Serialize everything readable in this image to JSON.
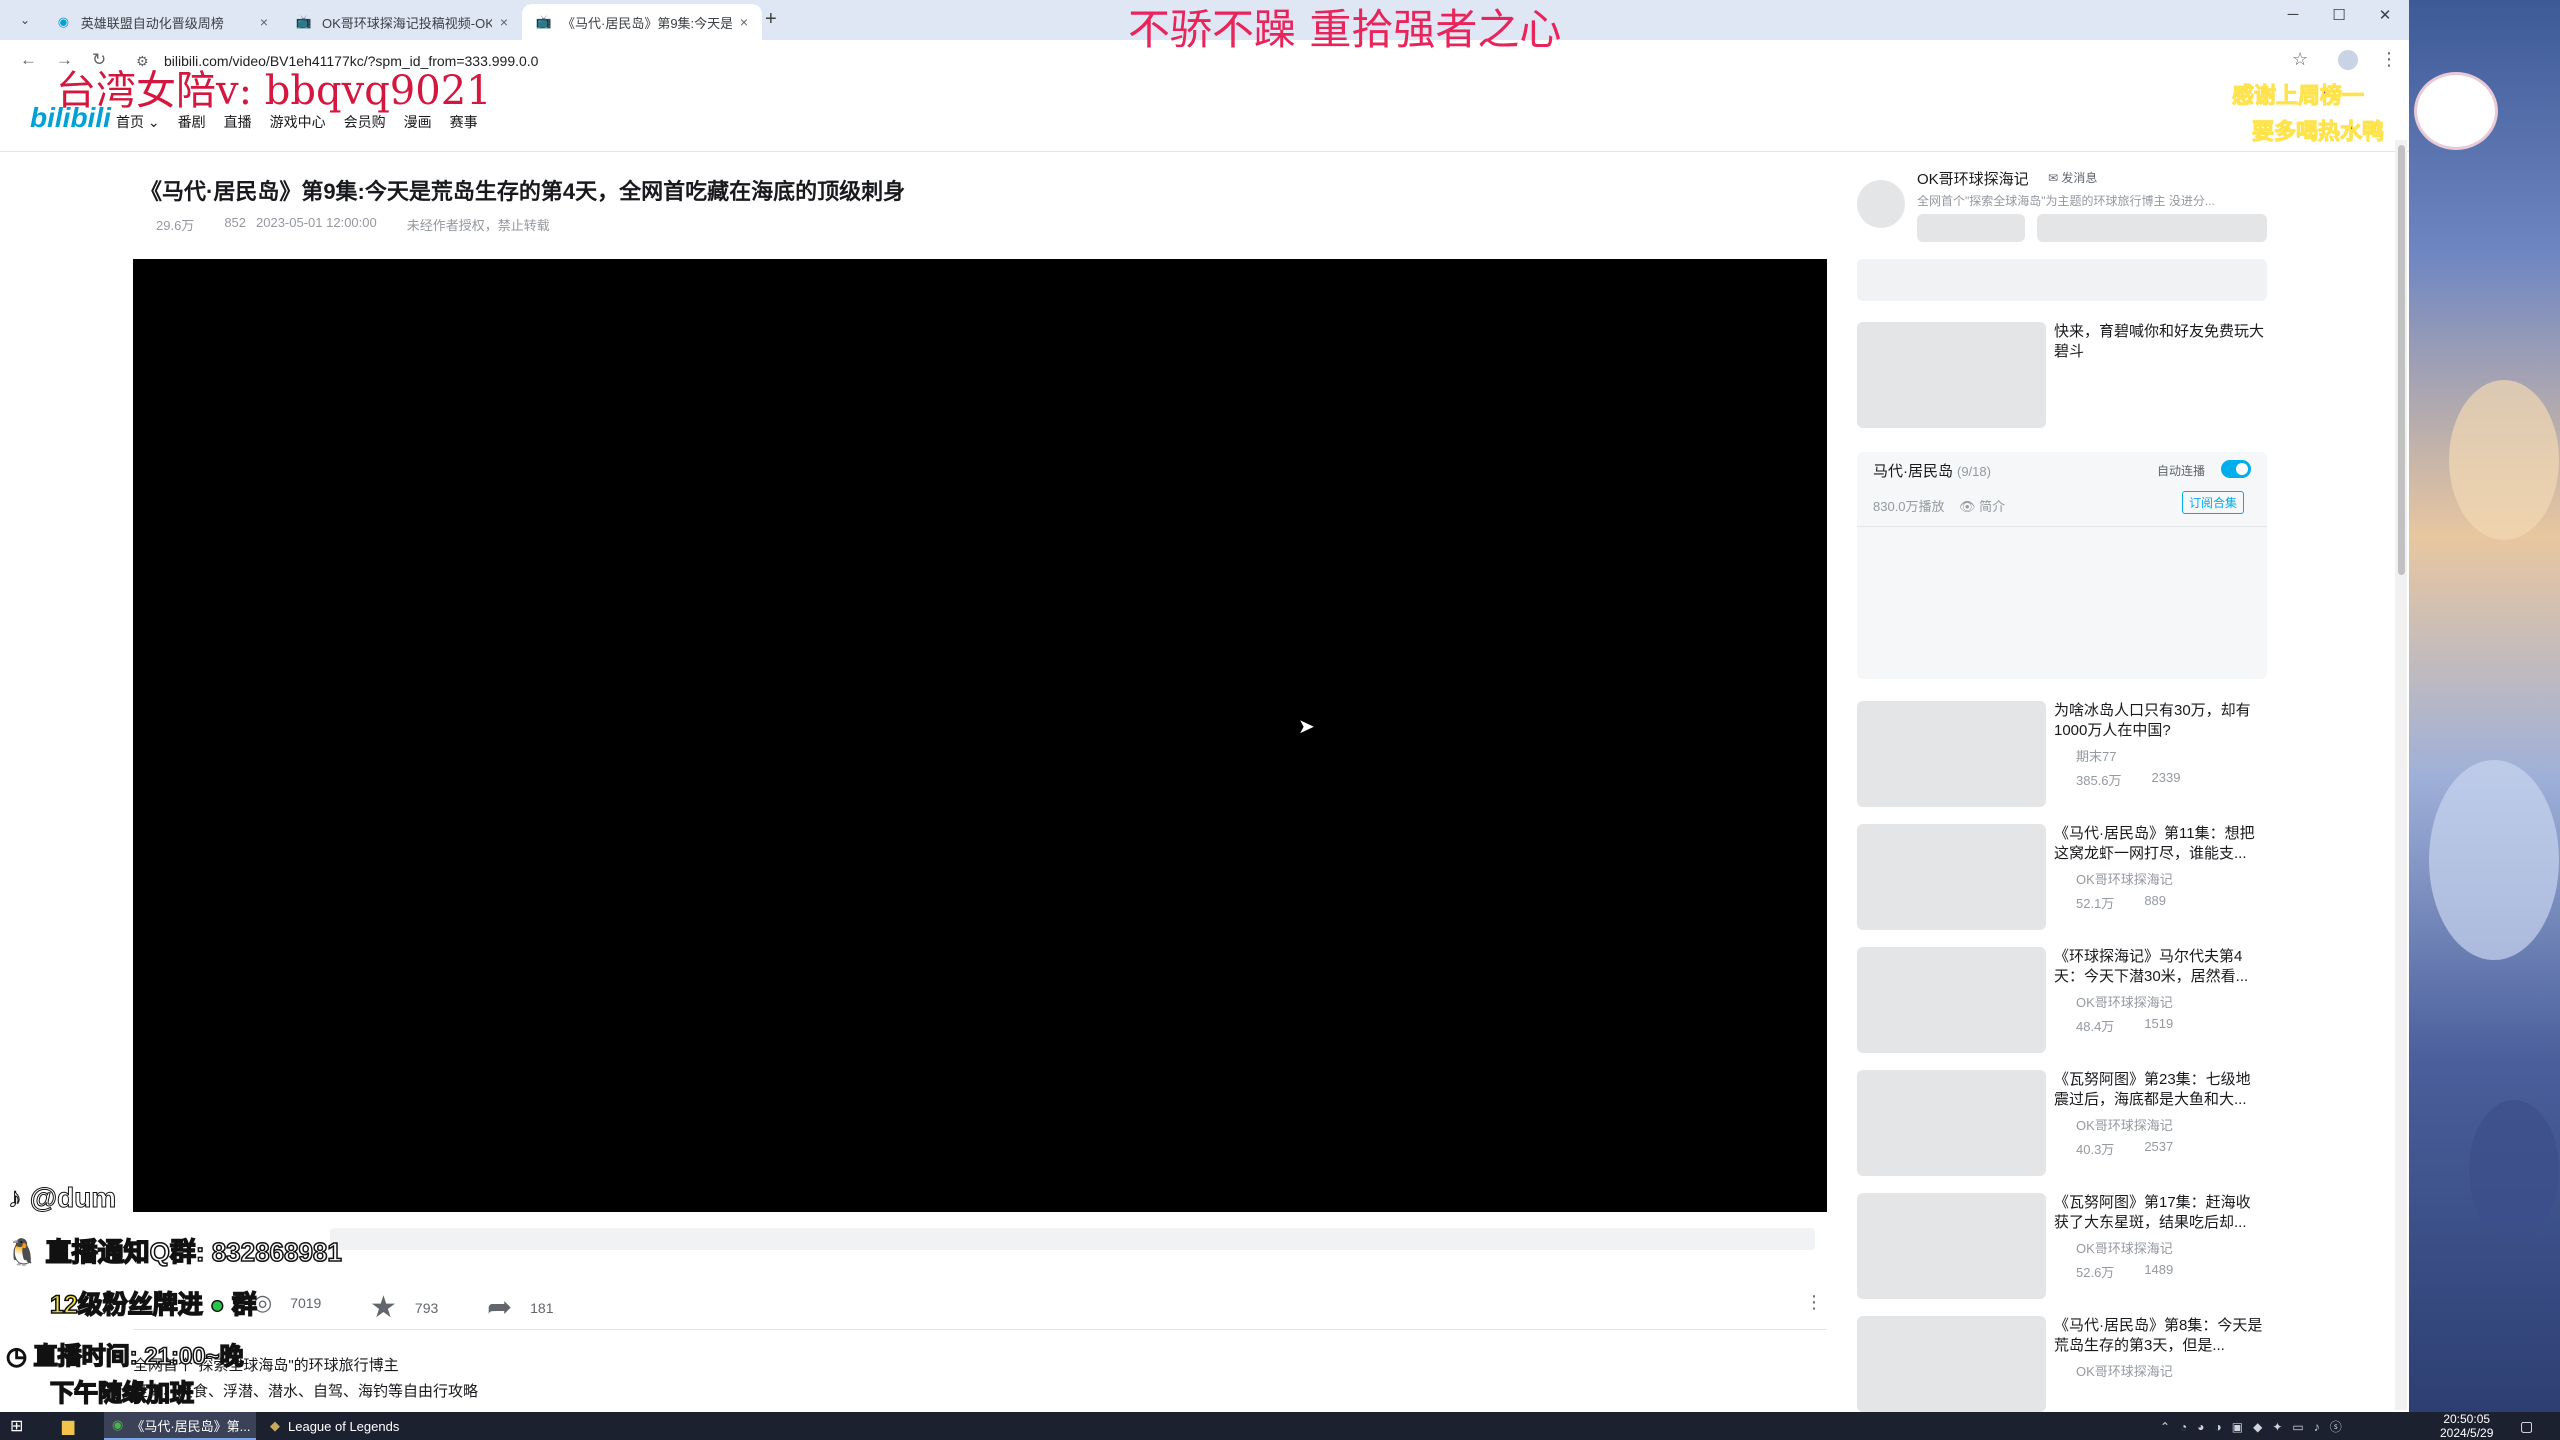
{
  "browser": {
    "tabs": [
      {
        "label": "英雄联盟自动化晋级周榜",
        "active": false
      },
      {
        "label": "OK哥环球探海记投稿视频-OK哥",
        "active": false
      },
      {
        "label": "《马代·居民岛》第9集:今天是荒",
        "active": true
      }
    ],
    "url": "bilibili.com/video/BV1eh41177kc/?spm_id_from=333.999.0.0",
    "icons": {
      "close": "×",
      "new_tab": "+",
      "minimize": "─",
      "maximize": "☐",
      "window_close": "✕",
      "back": "←",
      "forward": "→",
      "reload": "↻",
      "site_info": "⚙",
      "star": "☆",
      "menu": "⋮",
      "tab_list": "⌄"
    }
  },
  "bili_header": {
    "logo": "bilibili",
    "nav": [
      "首页 ⌄",
      "番剧",
      "直播",
      "游戏中心",
      "会员购",
      "漫画",
      "赛事"
    ]
  },
  "video": {
    "title": "《马代·居民岛》第9集:今天是荒岛生存的第4天，全网首吃藏在海底的顶级刺身",
    "views": "29.6万",
    "danmaku": "852",
    "date": "2023-05-01 12:00:00",
    "copyright": "未经作者授权，禁止转载",
    "coins": "7019",
    "favorites": "793",
    "shares": "181",
    "desc_line1": "全网首个\"探索全球海岛\"的环球旅行博主",
    "desc_line2": "赶海、美食、浮潜、潜水、自驾、海钓等自由行攻略"
  },
  "uploader": {
    "name": "OK哥环球探海记",
    "message": "✉ 发消息",
    "desc": "全网首个\"探索全球海岛\"为主题的环球旅行博主 没进分..."
  },
  "ad": {
    "title": "快来，育碧喊你和好友免费玩大碧斗"
  },
  "playlist": {
    "title": "马代·居民岛",
    "count": "(9/18)",
    "autoplay": "自动连播",
    "plays": "830.0万播放",
    "intro": "👁 简介",
    "subscribe": "订阅合集"
  },
  "recommendations": [
    {
      "title": "为啥冰岛人口只有30万，却有1000万人在中国?",
      "author": "期末77",
      "views": "385.6万",
      "danmaku": "2339"
    },
    {
      "title": "《马代·居民岛》第11集：想把这窝龙虾一网打尽，谁能支...",
      "author": "OK哥环球探海记",
      "views": "52.1万",
      "danmaku": "889"
    },
    {
      "title": "《环球探海记》马尔代夫第4天：今天下潜30米，居然看...",
      "author": "OK哥环球探海记",
      "views": "48.4万",
      "danmaku": "1519"
    },
    {
      "title": "《瓦努阿图》第23集：七级地震过后，海底都是大鱼和大...",
      "author": "OK哥环球探海记",
      "views": "40.3万",
      "danmaku": "2537"
    },
    {
      "title": "《瓦努阿图》第17集：赶海收获了大东星斑，结果吃后却...",
      "author": "OK哥环球探海记",
      "views": "52.6万",
      "danmaku": "1489"
    },
    {
      "title": "《马代·居民岛》第8集：今天是荒岛生存的第3天，但是...",
      "author": "OK哥环球探海记",
      "views": "",
      "danmaku": ""
    }
  ],
  "overlays": {
    "banner": "不骄不躁 重拾强者之心",
    "wechat": "台湾女陪v: bbqvq9021",
    "thanks": "感谢上周榜一",
    "water": "要多喝热水鸭",
    "tiktok": "@dum",
    "qq": "直播通知Q群: 832868981",
    "fans": "12级粉丝牌进",
    "fans_group": "群",
    "time": "直播时间: 21:00~晚",
    "afternoon": "下午随缘加班"
  },
  "taskbar": {
    "items": [
      "《马代·居民岛》第...",
      "League of Legends"
    ],
    "time": "20:50:05",
    "date": "2024/5/29"
  }
}
